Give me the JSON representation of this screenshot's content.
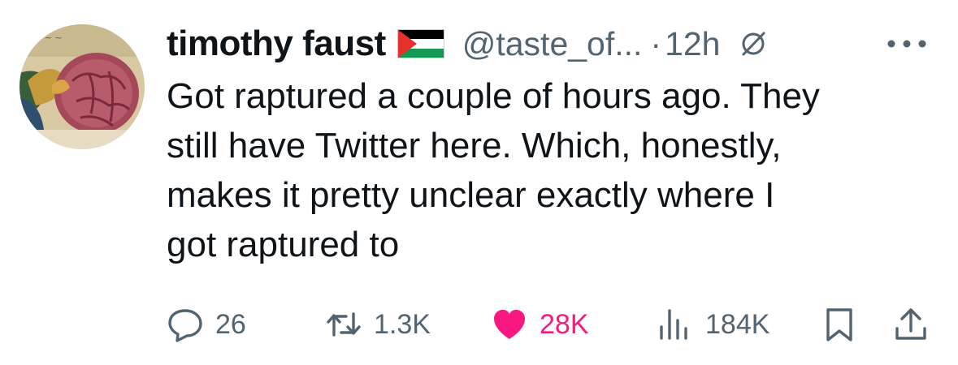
{
  "author": {
    "display_name": "timothy faust",
    "handle": "@taste_of...",
    "dot": "·",
    "time": "12h",
    "flag_icon": "palestine-flag-icon",
    "grok_icon": "grok-icon",
    "more_icon": "more-dots-icon"
  },
  "tweet": {
    "text": "Got raptured a couple of hours ago. They\nstill have Twitter here. Which, honestly,\nmakes it pretty unclear exactly where I\ngot raptured to"
  },
  "actions": {
    "reply_count": "26",
    "retweet_count": "1.3K",
    "like_count": "28K",
    "views_count": "184K",
    "liked": true
  },
  "colors": {
    "text_primary": "#0f1419",
    "text_secondary": "#536471",
    "like_active": "#f91880"
  }
}
